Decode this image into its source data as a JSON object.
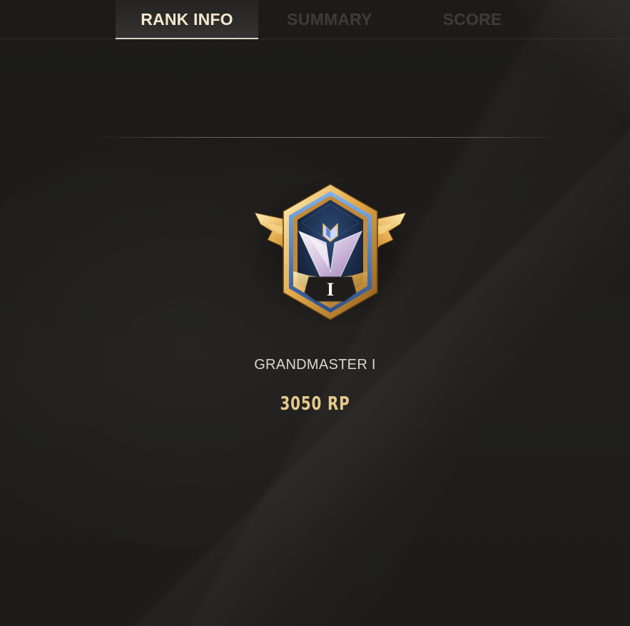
{
  "tabs": [
    {
      "label": "RANK INFO",
      "active": true
    },
    {
      "label": "SUMMARY",
      "active": false
    },
    {
      "label": "SCORE",
      "active": false
    }
  ],
  "rank": {
    "badge_numeral": "I",
    "name": "GRANDMASTER I",
    "points": "3050 RP"
  },
  "colors": {
    "active_tab_text": "#f3e9cf",
    "inactive_tab_text": "#3e3c39",
    "rank_name_text": "#ddd6c9",
    "points_text": "#e6c98c",
    "emblem_gold": "#d9a443",
    "emblem_blue": "#3f6fb4"
  },
  "icons": {
    "emblem": "grandmaster-rank-emblem-icon"
  }
}
